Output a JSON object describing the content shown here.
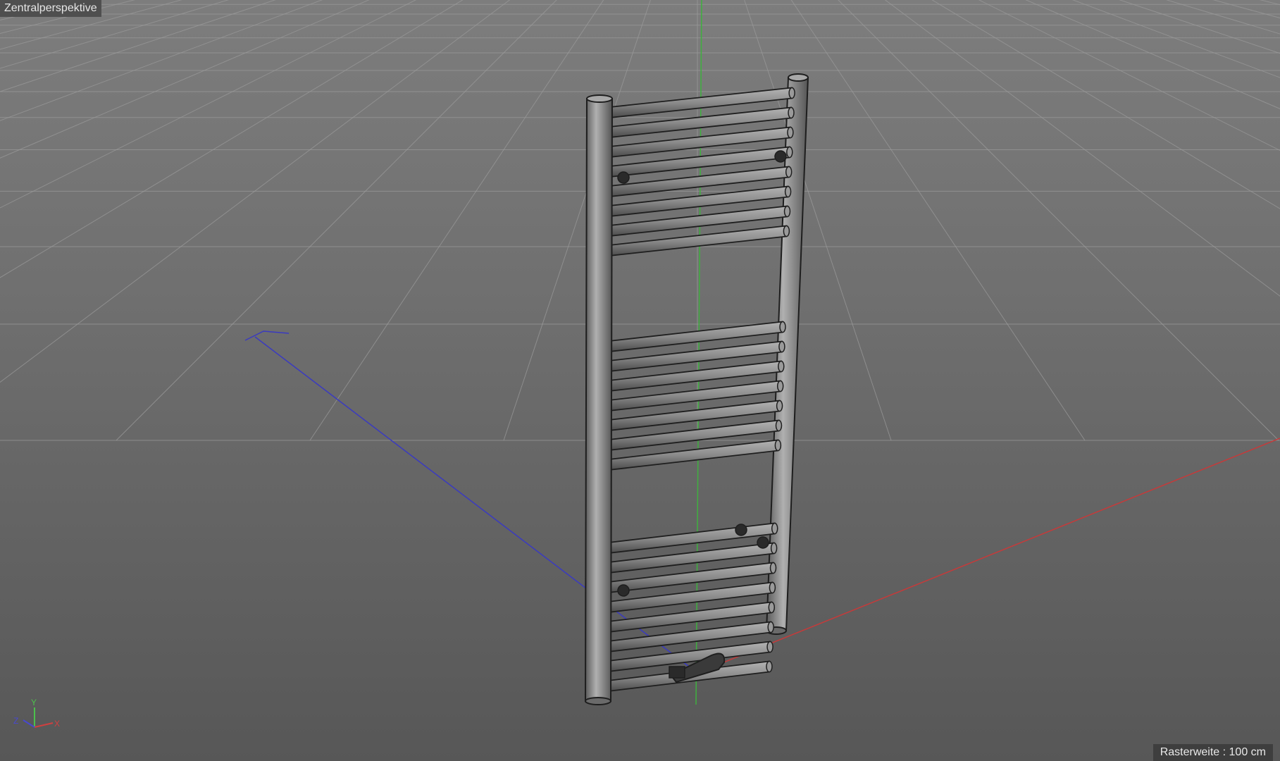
{
  "viewport": {
    "label": "Zentralperspektive",
    "status": "Rasterweite : 100 cm",
    "axes": {
      "x": "X",
      "y": "Y",
      "z": "Z"
    }
  },
  "colors": {
    "x_axis": "#c63a3a",
    "y_axis": "#3fb03f",
    "z_axis": "#3a3ac0",
    "grid_line": "#9a9a9a",
    "model_fill": "#8c8c8c",
    "model_outline": "#1e1e1e"
  },
  "model": {
    "name": "towel-radiator",
    "rail_groups": [
      8,
      7,
      8
    ]
  }
}
